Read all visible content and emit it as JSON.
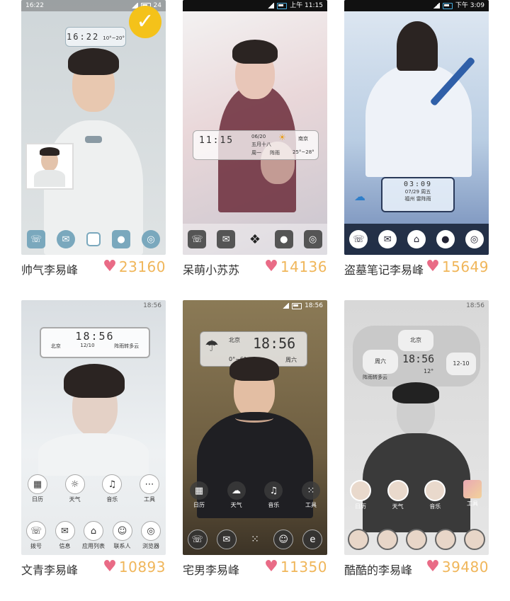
{
  "cards": [
    {
      "caption": "帅气李易峰",
      "likes": "23160",
      "status": {
        "left": "16:22",
        "right": "24"
      },
      "clock": {
        "time": "16:22",
        "weather": "10°~20°"
      },
      "selected": true,
      "icons": [
        "phone-icon",
        "message-icon",
        "home-square-icon",
        "contact-icon",
        "browser-icon"
      ]
    },
    {
      "caption": "呆萌小苏苏",
      "likes": "14136",
      "status": {
        "left": "",
        "right": "上午 11:15"
      },
      "clock": {
        "time": "11:15",
        "date": "06/20",
        "lunar": "五月十八",
        "weekday": "周一",
        "weather": "阵雨",
        "city": "南京",
        "temp": "25°~28°"
      },
      "icons": [
        "phone-icon",
        "message-icon",
        "diamond-icon",
        "contact-icon",
        "browser-icon"
      ]
    },
    {
      "caption": "盗墓笔记李易峰",
      "likes": "15649",
      "status": {
        "left": "",
        "right": "下午 3:09"
      },
      "clock": {
        "time": "03:09",
        "date": "07/29",
        "city": "福州",
        "weekday": "周五",
        "weather": "雷阵雨"
      },
      "icons": [
        "phone-icon",
        "message-icon",
        "home-icon",
        "contact-icon",
        "browser-icon"
      ]
    },
    {
      "caption": "文青李易峰",
      "likes": "10893",
      "status": {
        "left": "",
        "right": "18:56"
      },
      "clock": {
        "time": "18:56",
        "city": "北京",
        "date": "12/10",
        "weather": "阵雨转多云"
      },
      "apps_top": [
        "日历",
        "天气",
        "音乐",
        "工具"
      ],
      "apps_bottom": [
        "拨号",
        "信息",
        "应用列表",
        "联系人",
        "浏览器"
      ]
    },
    {
      "caption": "宅男李易峰",
      "likes": "11350",
      "status": {
        "left": "",
        "right": "18:56"
      },
      "clock": {
        "time": "18:56",
        "city": "北京",
        "temp": "0°~6°",
        "weekday": "周六"
      },
      "apps_top": [
        "日历",
        "天气",
        "音乐",
        "工具"
      ]
    },
    {
      "caption": "酷酷的李易峰",
      "likes": "39480",
      "status": {
        "left": "",
        "right": "18:56"
      },
      "clock": {
        "time": "18:56",
        "city": "北京",
        "weekday": "周六",
        "date": "12-10",
        "weather": "阵雨转多云",
        "temp": "12°"
      },
      "apps_top": [
        "日历",
        "天气",
        "音乐",
        "工具"
      ]
    }
  ],
  "colors": {
    "heart": "#e96b86",
    "count": "#f0b65a",
    "check": "#f4c21a"
  }
}
